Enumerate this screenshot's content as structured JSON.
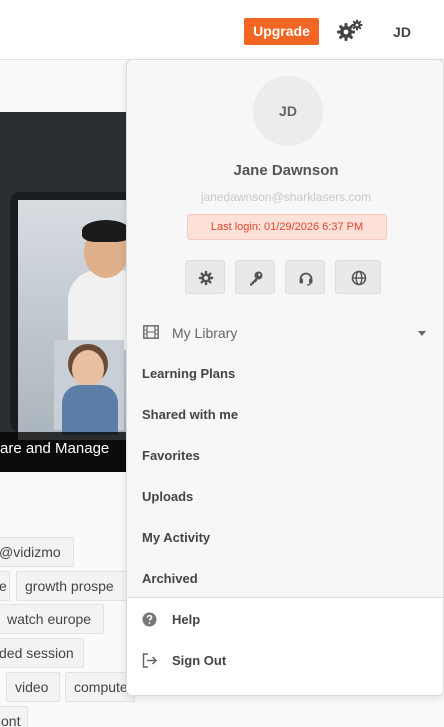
{
  "header": {
    "upgrade_label": "Upgrade",
    "settings_icon": "gears-icon",
    "user_initials": "JD"
  },
  "background": {
    "video_title": "are and Manage",
    "tags": [
      "@vidizmo",
      "e",
      "growth prospe",
      "watch europe",
      "ded session",
      "video",
      "compute",
      "ont"
    ]
  },
  "profile": {
    "avatar_initials": "JD",
    "name": "Jane Dawnson",
    "email": "janedawnson@sharklasers.com",
    "last_login": "Last login: 01/29/2026 6:37 PM",
    "quick_actions": [
      {
        "icon": "gear-icon"
      },
      {
        "icon": "key-icon"
      },
      {
        "icon": "headset-icon"
      },
      {
        "icon": "globe-icon"
      }
    ]
  },
  "library": {
    "label": "My Library",
    "icon": "film-icon",
    "items": [
      {
        "label": "Learning Plans"
      },
      {
        "label": "Shared with me"
      },
      {
        "label": "Favorites"
      },
      {
        "label": "Uploads"
      },
      {
        "label": "My Activity"
      },
      {
        "label": "Archived"
      }
    ]
  },
  "footer_menu": {
    "help_label": "Help",
    "sign_out_label": "Sign Out"
  },
  "colors": {
    "accent": "#f26522",
    "login_bg": "#fde1d9",
    "login_text": "#e0452b"
  }
}
